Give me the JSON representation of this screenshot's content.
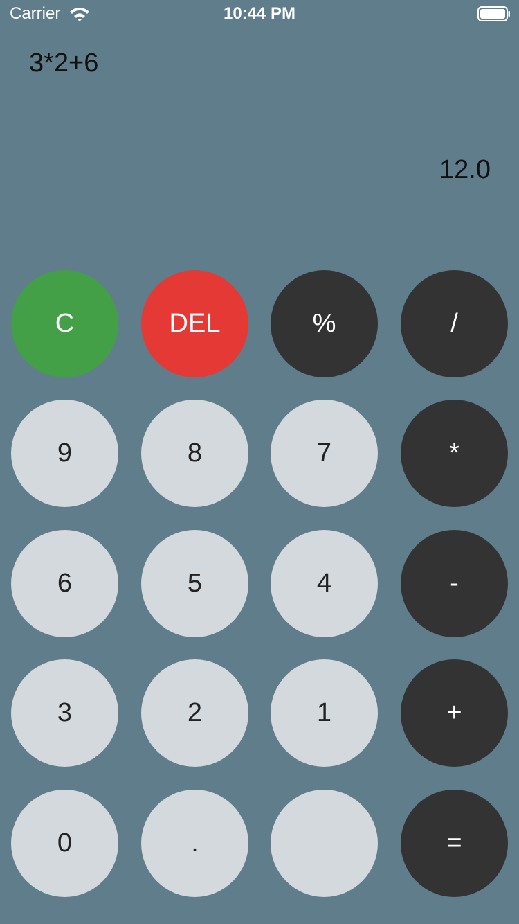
{
  "status_bar": {
    "carrier": "Carrier",
    "time": "10:44 PM"
  },
  "display": {
    "expression": "3*2+6",
    "result": "12.0"
  },
  "keys": {
    "clear": "C",
    "delete": "DEL",
    "percent": "%",
    "divide": "/",
    "nine": "9",
    "eight": "8",
    "seven": "7",
    "multiply": "*",
    "six": "6",
    "five": "5",
    "four": "4",
    "minus": "-",
    "three": "3",
    "two": "2",
    "one": "1",
    "plus": "+",
    "zero": "0",
    "decimal": ".",
    "blank": "",
    "equals": "="
  },
  "colors": {
    "background": "#607d8b",
    "clear_key": "#43a047",
    "delete_key": "#e53935",
    "operator_key": "#333333",
    "number_key": "#d3d9dd"
  },
  "icons": [
    "wifi-icon",
    "battery-icon"
  ]
}
